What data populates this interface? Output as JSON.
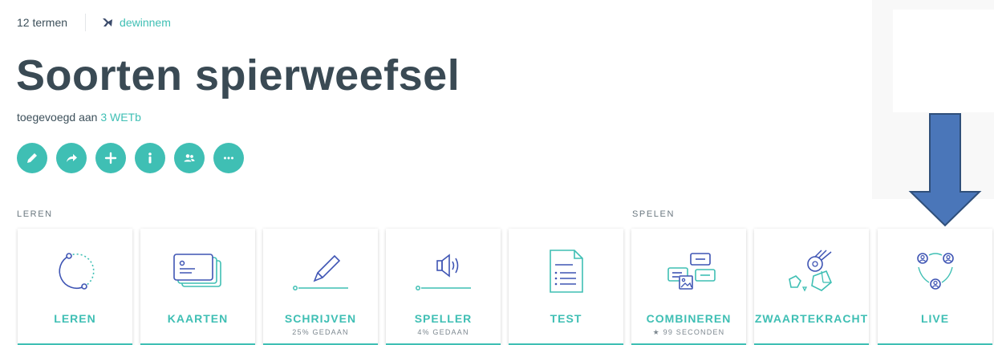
{
  "header": {
    "term_count": "12 termen",
    "username": "dewinnem"
  },
  "set": {
    "title": "Soorten spierweefsel",
    "added_prefix": "toegevoegd aan",
    "added_class": "3 WETb"
  },
  "actions": [
    {
      "icon": "pencil-icon"
    },
    {
      "icon": "share-icon"
    },
    {
      "icon": "plus-icon"
    },
    {
      "icon": "info-icon"
    },
    {
      "icon": "people-icon"
    },
    {
      "icon": "more-icon"
    }
  ],
  "sections": {
    "study": "LEREN",
    "play": "SPELEN"
  },
  "modes": [
    {
      "label": "LEREN",
      "sub": ""
    },
    {
      "label": "KAARTEN",
      "sub": ""
    },
    {
      "label": "SCHRIJVEN",
      "sub": "25% GEDAAN"
    },
    {
      "label": "SPELLER",
      "sub": "4% GEDAAN"
    },
    {
      "label": "TEST",
      "sub": ""
    },
    {
      "label": "COMBINEREN",
      "sub": "★ 99 SECONDEN"
    },
    {
      "label": "ZWAARTEKRACHT",
      "sub": ""
    },
    {
      "label": "LIVE",
      "sub": ""
    }
  ],
  "colors": {
    "accent": "#3fbfb4",
    "icon_stroke": "#3f55b4",
    "title": "#3a4a54",
    "arrow_fill": "#4a76b9",
    "arrow_stroke": "#2f4f7a"
  }
}
